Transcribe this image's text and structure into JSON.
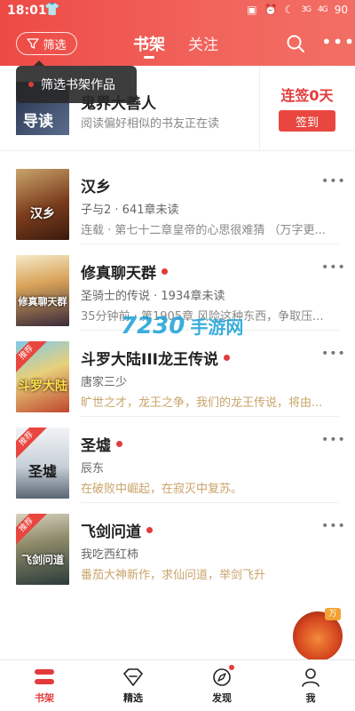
{
  "status_bar": {
    "time": "18:01",
    "signal_1": "3G",
    "signal_2": "4G",
    "battery": "90"
  },
  "header": {
    "filter_label": "筛选",
    "tabs": [
      {
        "label": "书架",
        "active": true
      },
      {
        "label": "关注",
        "active": false
      }
    ],
    "accent_color": "#ee4a45"
  },
  "tooltip": {
    "text": "筛选书架作品"
  },
  "signin": {
    "cover_text": "导读",
    "title": "鬼界大善人",
    "desc": "阅读偏好相似的书友正在读",
    "streak": "连签0天",
    "button": "签到"
  },
  "books": [
    {
      "title": "汉乡",
      "meta": "子与2 · 641章未读",
      "update": "连载 · 第七十二章皇帝的心思很难猜 （万字更...",
      "has_new": false,
      "badge": "",
      "cover_text": "汉乡"
    },
    {
      "title": "修真聊天群",
      "meta": "圣骑士的传说 · 1934章未读",
      "update": "35分钟前 · 第1905章 风险这种东西，争取压...",
      "has_new": true,
      "badge": "",
      "cover_text": "修真聊天群"
    },
    {
      "title": "斗罗大陆III龙王传说",
      "meta": "唐家三少",
      "update": "旷世之才，龙王之争，我们的龙王传说，将由...",
      "has_new": true,
      "badge": "推荐",
      "cover_text": "斗罗大陆"
    },
    {
      "title": "圣墟",
      "meta": "辰东",
      "update": "在破败中崛起，在寂灭中复苏。",
      "has_new": true,
      "badge": "推荐",
      "cover_text": "圣墟"
    },
    {
      "title": "飞剑问道",
      "meta": "我吃西红柿",
      "update": "番茄大神新作，求仙问道，举剑飞升",
      "has_new": true,
      "badge": "推荐",
      "cover_text": "飞剑问道"
    }
  ],
  "watermark": {
    "num": "7230",
    "cn": "手游网"
  },
  "float_badge": {
    "tag": "万"
  },
  "tabbar": [
    {
      "label": "书架",
      "icon": "bookshelf-icon",
      "active": true,
      "dot": false
    },
    {
      "label": "精选",
      "icon": "diamond-icon",
      "active": false,
      "dot": false
    },
    {
      "label": "发现",
      "icon": "compass-icon",
      "active": false,
      "dot": true
    },
    {
      "label": "我",
      "icon": "person-icon",
      "active": false,
      "dot": false
    }
  ]
}
